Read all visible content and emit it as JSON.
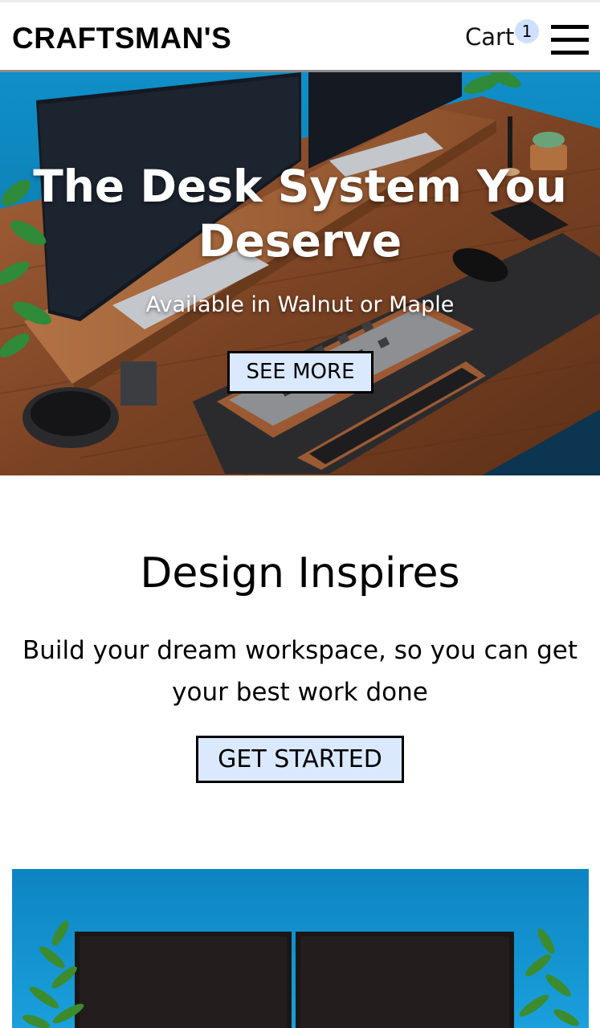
{
  "header": {
    "brand": "CRAFTSMAN'S",
    "cart_label": "Cart",
    "cart_count": "1",
    "menu_icon": "hamburger-menu-icon"
  },
  "hero": {
    "title": "The Desk System You Deserve",
    "subtitle": "Available in Walnut or Maple",
    "button_label": "SEE MORE"
  },
  "design": {
    "title": "Design Inspires",
    "text": "Build your dream workspace, so you can get your best work done",
    "button_label": "GET STARTED"
  },
  "colors": {
    "button_bg": "#dbe9ff",
    "badge_bg": "#cfe0ff",
    "wall_blue": "#1f9fd8",
    "walnut": "#8a4f2a"
  }
}
